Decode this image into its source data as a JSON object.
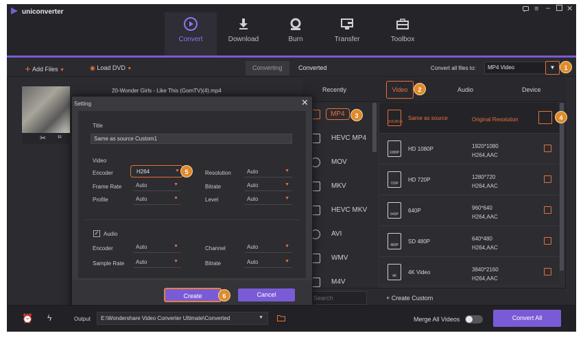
{
  "app": {
    "name": "uniconverter",
    "accent": "#7a5bd6",
    "highlight": "#e8713a"
  },
  "nav": {
    "items": [
      {
        "label": "Convert",
        "icon": "convert-icon"
      },
      {
        "label": "Download",
        "icon": "download-icon"
      },
      {
        "label": "Burn",
        "icon": "burn-icon"
      },
      {
        "label": "Transfer",
        "icon": "transfer-icon"
      },
      {
        "label": "Toolbox",
        "icon": "toolbox-icon"
      }
    ],
    "active": "Convert"
  },
  "toolbar": {
    "add_files": "Add Files",
    "load_dvd": "Load DVD",
    "tab_converting": "Converting",
    "tab_converted": "Converted",
    "convert_all_to_label": "Convert all files to:",
    "convert_all_to_value": "MP4 Video"
  },
  "file": {
    "name": "20-Wonder Girls - Like This (GomTV)(4).mp4"
  },
  "format_panel": {
    "tabs": [
      "Recently",
      "Video",
      "Audio",
      "Device"
    ],
    "active_tab": "Video",
    "formats": [
      "MP4",
      "HEVC MP4",
      "MOV",
      "MKV",
      "HEVC MKV",
      "AVI",
      "WMV",
      "M4V"
    ],
    "selected_format": "MP4",
    "presets": [
      {
        "name": "Same as source",
        "resolution": "Original Resolution",
        "codec": "",
        "icon_label": "SOURCE"
      },
      {
        "name": "HD 1080P",
        "resolution": "1920*1080",
        "codec": "H264,AAC",
        "icon_label": "1080P"
      },
      {
        "name": "HD 720P",
        "resolution": "1280*720",
        "codec": "H264,AAC",
        "icon_label": "720P"
      },
      {
        "name": "640P",
        "resolution": "960*640",
        "codec": "H264,AAC",
        "icon_label": "640P"
      },
      {
        "name": "SD 480P",
        "resolution": "640*480",
        "codec": "H264,AAC",
        "icon_label": "480P"
      },
      {
        "name": "4K Video",
        "resolution": "3840*2160",
        "codec": "H264,AAC",
        "icon_label": "4K"
      }
    ],
    "search_placeholder": "Search",
    "create_custom": "+ Create Custom"
  },
  "setting_dialog": {
    "title": "Setting",
    "title_label": "Title",
    "title_value": "Same as source Custom1",
    "video_section": "Video",
    "encoder_label": "Encoder",
    "encoder_value": "H264",
    "frame_rate_label": "Frame Rate",
    "frame_rate_value": "Auto",
    "profile_label": "Profile",
    "profile_value": "Auto",
    "resolution_label": "Resolution",
    "resolution_value": "Auto",
    "bitrate_label": "Bitrate",
    "bitrate_value": "Auto",
    "level_label": "Level",
    "level_value": "Auto",
    "audio_section": "Audio",
    "audio_checked": true,
    "audio_encoder_label": "Encoder",
    "audio_encoder_value": "Auto",
    "sample_rate_label": "Sample Rate",
    "sample_rate_value": "Auto",
    "channel_label": "Channel",
    "channel_value": "Auto",
    "audio_bitrate_label": "Bitrate",
    "audio_bitrate_value": "Auto",
    "create_button": "Create",
    "cancel_button": "Cancel"
  },
  "bottom": {
    "output_label": "Output",
    "output_path": "E:\\Wondershare Video Converter Ultimate\\Converted",
    "merge_label": "Merge All Videos",
    "merge_on": false,
    "convert_all": "Convert All"
  },
  "badges": [
    "1",
    "2",
    "3",
    "4",
    "5",
    "6"
  ]
}
